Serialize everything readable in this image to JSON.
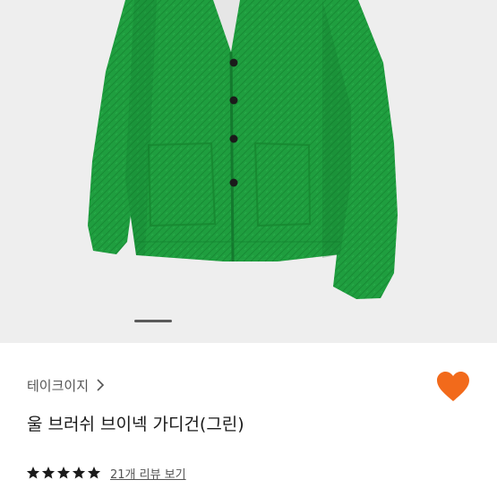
{
  "product": {
    "brand": "테이크이지",
    "title": "울 브러쉬 브이넥 가디건(그린)",
    "rating": 5,
    "max_rating": 5,
    "reviews_link": "21개 리뷰 보기",
    "favorited": true
  },
  "gallery": {
    "current_slide": 1
  },
  "icons": {
    "brand_link": "chevron-right-icon",
    "favorite": "heart-icon",
    "rating": "star-icon"
  },
  "colors": {
    "accent": "#f26a1b",
    "garment": "#1c9a3c",
    "hero_bg": "#eeeeee",
    "star": "#1a1a1a"
  }
}
